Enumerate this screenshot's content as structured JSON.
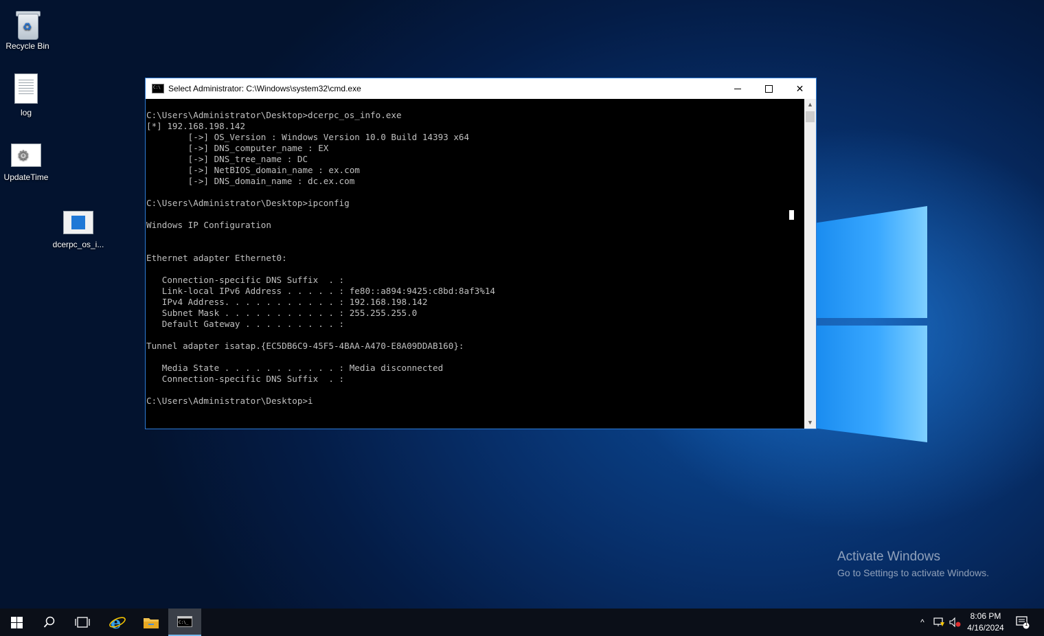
{
  "desktop": {
    "icons": [
      {
        "label": "Recycle Bin",
        "icon": "recycle-bin-icon"
      },
      {
        "label": "log",
        "icon": "text-file-icon"
      },
      {
        "label": "UpdateTime",
        "icon": "settings-app-icon"
      },
      {
        "label": "dcerpc_os_i...",
        "icon": "executable-icon"
      }
    ]
  },
  "window": {
    "title": "Select Administrator: C:\\Windows\\system32\\cmd.exe",
    "console_text": "C:\\Users\\Administrator\\Desktop>dcerpc_os_info.exe\n[*] 192.168.198.142\n        [->] OS_Version : Windows Version 10.0 Build 14393 x64\n        [->] DNS_computer_name : EX\n        [->] DNS_tree_name : DC\n        [->] NetBIOS_domain_name : ex.com\n        [->] DNS_domain_name : dc.ex.com\n\nC:\\Users\\Administrator\\Desktop>ipconfig\n\nWindows IP Configuration\n\n\nEthernet adapter Ethernet0:\n\n   Connection-specific DNS Suffix  . :\n   Link-local IPv6 Address . . . . . : fe80::a894:9425:c8bd:8af3%14\n   IPv4 Address. . . . . . . . . . . : 192.168.198.142\n   Subnet Mask . . . . . . . . . . . : 255.255.255.0\n   Default Gateway . . . . . . . . . :\n\nTunnel adapter isatap.{EC5DB6C9-45F5-4BAA-A470-E8A09DDAB160}:\n\n   Media State . . . . . . . . . . . : Media disconnected\n   Connection-specific DNS Suffix  . :\n\nC:\\Users\\Administrator\\Desktop>i",
    "buttons": {
      "minimize": "minimize-icon",
      "maximize": "maximize-icon",
      "close": "✕"
    }
  },
  "watermark": {
    "line1": "Activate Windows",
    "line2": "Go to Settings to activate Windows."
  },
  "taskbar": {
    "time": "8:06 PM",
    "date": "4/16/2024",
    "notification_count": "1",
    "tray_chevron": "^"
  }
}
